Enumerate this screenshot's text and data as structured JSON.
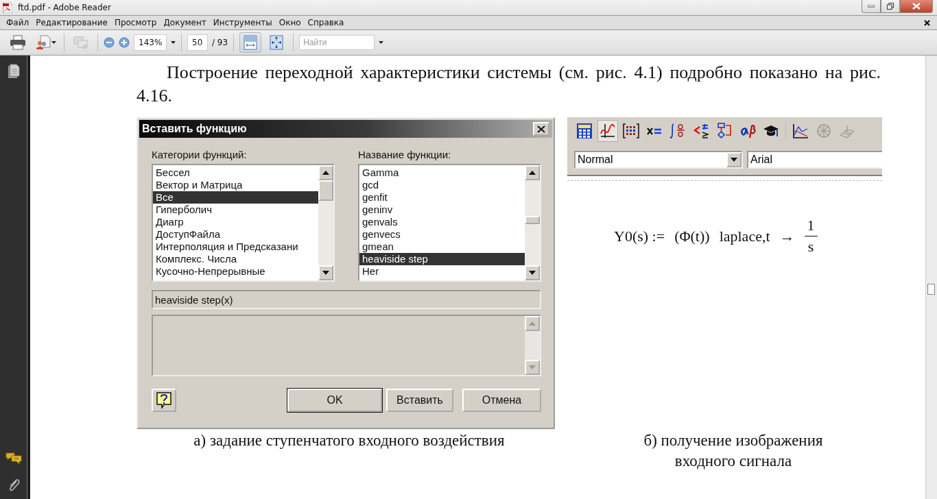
{
  "window": {
    "title": "ftd.pdf - Adobe Reader"
  },
  "menu": [
    "Файл",
    "Редактирование",
    "Просмотр",
    "Документ",
    "Инструменты",
    "Окно",
    "Справка"
  ],
  "toolbar": {
    "zoom": "143%",
    "page": "50",
    "page_total": "/ 93",
    "search_placeholder": "Найти",
    "fit_width_pressed": true
  },
  "document": {
    "paragraph": "Построение переходной характеристики системы (см. рис. 4.1) подробно показано на рис. 4.16.",
    "dialog": {
      "title": "Вставить функцию",
      "categories_label": "Категории функций:",
      "functions_label": "Название функции:",
      "categories": [
        {
          "label": "Бессел",
          "selected": false
        },
        {
          "label": "Вектор и Матрица",
          "selected": false
        },
        {
          "label": "Все",
          "selected": true
        },
        {
          "label": "Гиперболич",
          "selected": false
        },
        {
          "label": "Диагр",
          "selected": false
        },
        {
          "label": "ДоступФайла",
          "selected": false
        },
        {
          "label": "Интерполяция и Предсказани",
          "selected": false
        },
        {
          "label": "Комплекс. Числа",
          "selected": false
        },
        {
          "label": "Кусочно-Непрерывные",
          "selected": false
        }
      ],
      "functions": [
        {
          "label": "Gamma",
          "selected": false
        },
        {
          "label": "gcd",
          "selected": false
        },
        {
          "label": "genfit",
          "selected": false
        },
        {
          "label": "geninv",
          "selected": false
        },
        {
          "label": "genvals",
          "selected": false
        },
        {
          "label": "genvecs",
          "selected": false
        },
        {
          "label": "gmean",
          "selected": false
        },
        {
          "label": "heaviside step",
          "selected": true
        },
        {
          "label": "Her",
          "selected": false
        }
      ],
      "signature": "heaviside step(x)",
      "buttons": [
        {
          "label": "OK",
          "kind": "default"
        },
        {
          "label": "Вставить",
          "kind": "normal"
        },
        {
          "label": "Отмена",
          "kind": "normal"
        }
      ]
    },
    "mathcad": {
      "style": "Normal",
      "font": "Arial",
      "formula": {
        "lhs": "Y0(s) :=",
        "argument": "(Φ(t))",
        "operator": "laplace,t",
        "arrow": "→",
        "numerator": "1",
        "denominator": "s"
      }
    },
    "captions": [
      "а)  задание ступенчатого входного воздействия",
      "б) получение изображения входного сигнала"
    ]
  }
}
